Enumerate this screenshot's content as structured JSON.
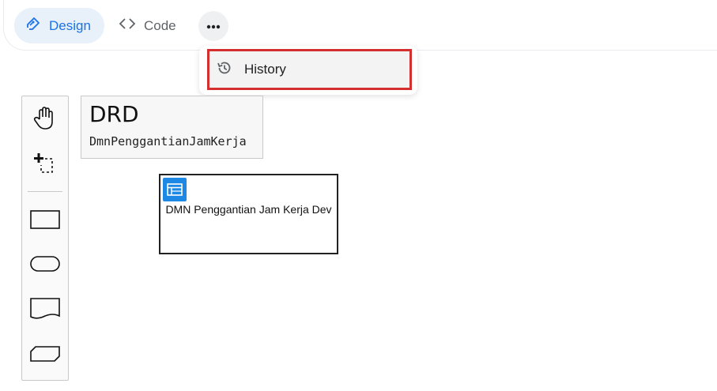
{
  "toolbar": {
    "design_label": "Design",
    "code_label": "Code"
  },
  "menu": {
    "history_label": "History"
  },
  "drd": {
    "title": "DRD",
    "name": "DmnPenggantianJamKerja"
  },
  "decision": {
    "label": "DMN Penggantian Jam Kerja Dev"
  },
  "colors": {
    "accent": "#1a73e8",
    "design_tab_bg": "#e8f0fa",
    "highlight_border": "#d32f2f",
    "decision_badge": "#1e88e5"
  },
  "icons": {
    "design": "pen-icon",
    "code": "code-brackets-icon",
    "more": "more-horizontal-icon",
    "history": "history-icon",
    "hand_tool": "hand-tool-icon",
    "lasso_tool": "lasso-tool-icon",
    "decision_tool": "decision-shape-icon",
    "input_data_tool": "input-data-shape-icon",
    "knowledge_tool": "knowledge-source-shape-icon",
    "bkm_tool": "business-knowledge-model-shape-icon",
    "decision_table": "decision-table-icon"
  }
}
